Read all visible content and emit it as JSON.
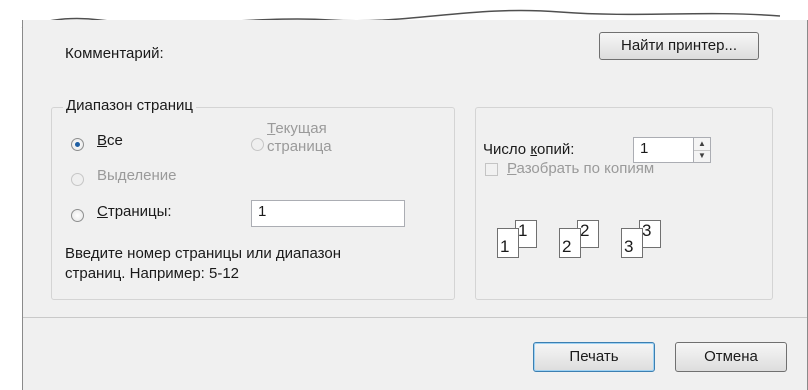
{
  "comment": {
    "label": "Комментарий:"
  },
  "find_printer": {
    "label": "Найти принтер..."
  },
  "page_range": {
    "title": "Диапазон страниц",
    "all": {
      "accel": "В",
      "rest": "се"
    },
    "current_page": {
      "accel": "Т",
      "line1_rest": "екущая",
      "line2": "страница"
    },
    "selection": {
      "pre": "Вы",
      "accel": "д",
      "rest": "еление"
    },
    "pages": {
      "accel": "С",
      "rest": "траницы:",
      "value": "1"
    },
    "hint_line1": "Введите номер страницы или диапазон",
    "hint_line2": "страниц.  Например: 5-12"
  },
  "copies": {
    "label_pre": "Число ",
    "label_accel": "к",
    "label_rest": "опий:",
    "value": "1",
    "collate": {
      "accel": "Р",
      "rest": "азобрать по копиям"
    },
    "collate_icons": [
      {
        "back": "1",
        "front": "1"
      },
      {
        "back": "2",
        "front": "2"
      },
      {
        "back": "3",
        "front": "3"
      }
    ]
  },
  "footer": {
    "print_label": "Печать",
    "cancel_label": "Отмена"
  }
}
